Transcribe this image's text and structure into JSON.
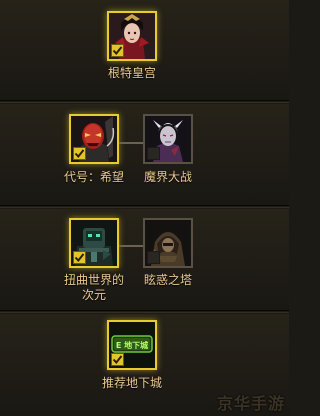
{
  "tree": {
    "tiers": [
      {
        "nodes": [
          {
            "label": "根特皇宫",
            "checked": true,
            "selected": true,
            "portrait": "empress-portrait"
          }
        ]
      },
      {
        "nodes": [
          {
            "label": "代号：希望",
            "checked": true,
            "selected": true,
            "portrait": "red-mask-portrait"
          },
          {
            "label": "魔界大战",
            "checked": false,
            "selected": false,
            "portrait": "pale-demon-portrait"
          }
        ]
      },
      {
        "nodes": [
          {
            "label": "扭曲世界的次元",
            "label_line1": "扭曲世界的",
            "label_line2": "次元",
            "checked": true,
            "selected": true,
            "portrait": "twisted-machine-portrait"
          },
          {
            "label": "眩惑之塔",
            "checked": false,
            "selected": false,
            "portrait": "hooded-figure-portrait"
          }
        ]
      },
      {
        "nodes": [
          {
            "label": "推荐地下城",
            "checked": true,
            "selected": true,
            "portrait": "dungeon-badge",
            "badge_text": "E 地下城"
          }
        ]
      }
    ]
  },
  "watermark": "京华手游",
  "colors": {
    "accent": "#e6cc2c",
    "label": "#e8c98f",
    "background": "#1c1a15"
  }
}
